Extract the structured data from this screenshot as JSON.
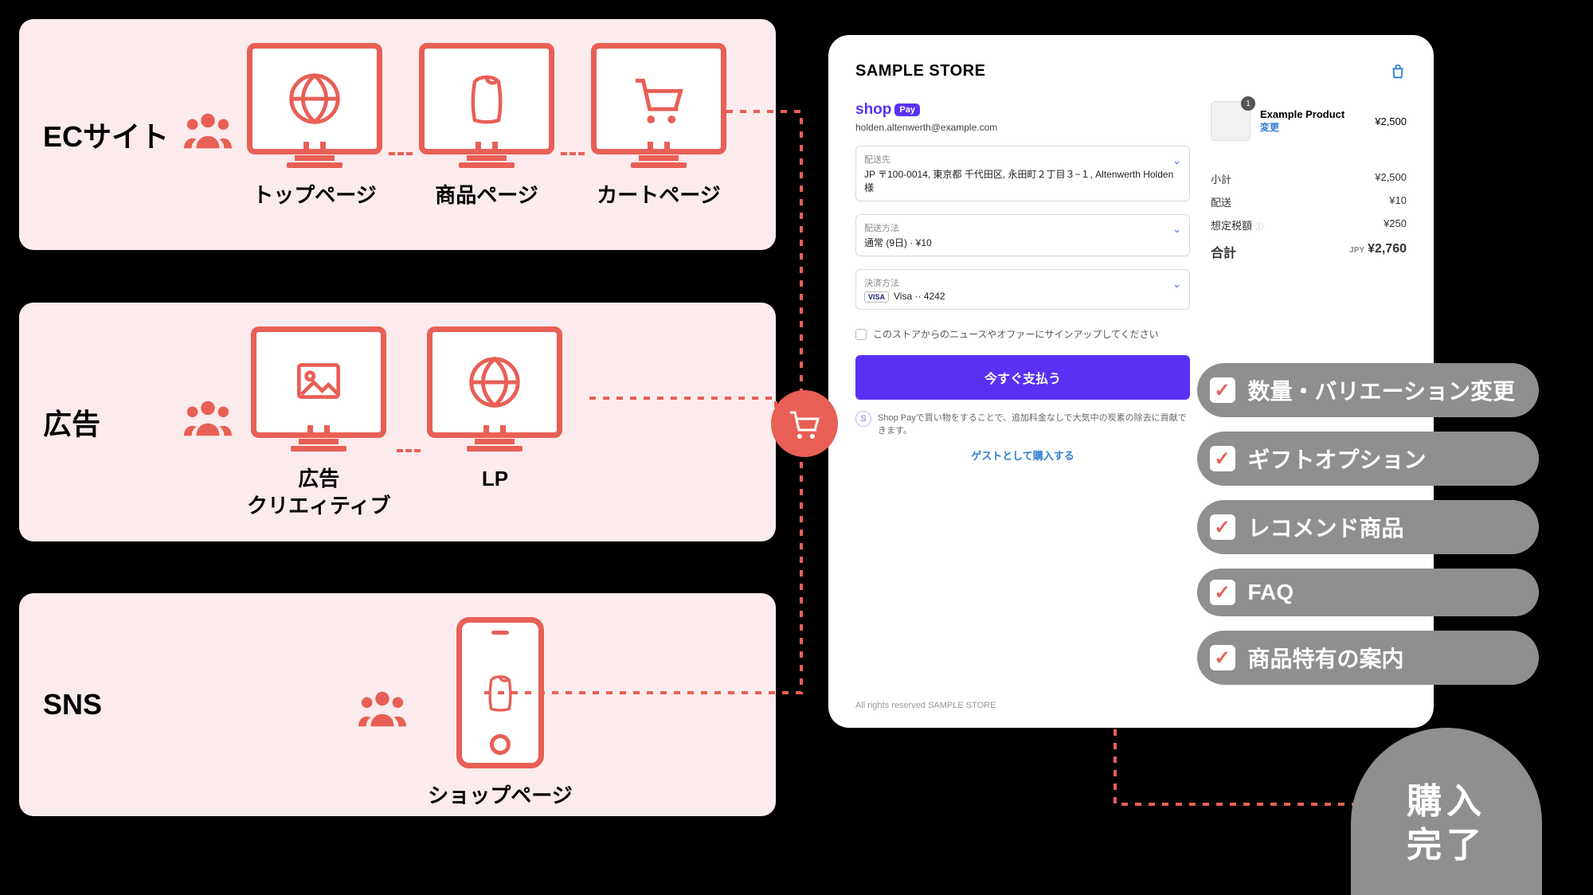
{
  "sources": {
    "ec": {
      "label": "ECサイト",
      "cards": [
        "トップページ",
        "商品ページ",
        "カートページ"
      ],
      "icons": [
        "globe",
        "shirt",
        "cart"
      ]
    },
    "ad": {
      "label": "広告",
      "cards": [
        "広告\nクリエィティブ",
        "LP"
      ],
      "icons": [
        "image",
        "globe"
      ]
    },
    "sns": {
      "label": "SNS",
      "cards": [
        "ショップページ"
      ],
      "icons": [
        "shirt"
      ]
    }
  },
  "checkout": {
    "store": "SAMPLE STORE",
    "shoppay": "shop",
    "shoppay_tag": "Pay",
    "email": "holden.altenwerth@example.com",
    "ship_to_label": "配送先",
    "ship_to_value": "JP 〒100-0014, 東京都 千代田区, 永田町２丁目３−１, Altenwerth Holden様",
    "ship_method_label": "配送方法",
    "ship_method_value": "通常 (9日) · ¥10",
    "pay_method_label": "決済方法",
    "pay_method_value": "Visa ·· 4242",
    "newsletter": "このストアからのニュースやオファーにサインアップしてください",
    "pay_button": "今すぐ支払う",
    "carbon_note": "Shop Payで買い物をすることで、追加料金なしで大気中の炭素の除去に貢献できます。",
    "guest_link": "ゲストとして購入する",
    "footer": "All rights reserved SAMPLE STORE",
    "product": {
      "name": "Example Product",
      "change": "変更",
      "qty": "1",
      "price": "¥2,500"
    },
    "summary": {
      "subtotal_label": "小計",
      "subtotal": "¥2,500",
      "shipping_label": "配送",
      "shipping": "¥10",
      "tax_label": "想定税額",
      "tax": "¥250",
      "total_label": "合計",
      "currency": "JPY",
      "total": "¥2,760"
    }
  },
  "features": [
    "数量・バリエーション変更",
    "ギフトオプション",
    "レコメンド商品",
    "FAQ",
    "商品特有の案内"
  ],
  "done": "購入\n完了"
}
